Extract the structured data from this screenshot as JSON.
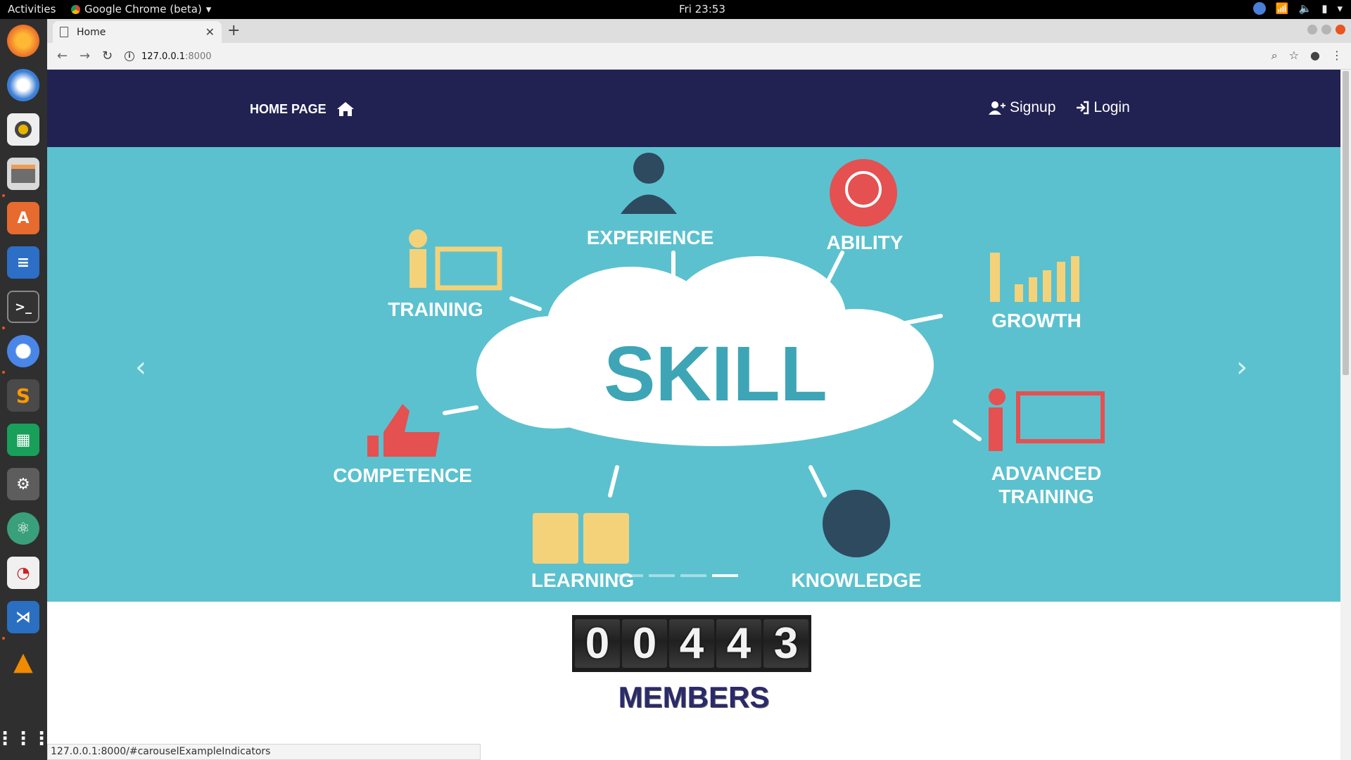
{
  "topbar": {
    "activities": "Activities",
    "app_name": "Google Chrome (beta)",
    "clock": "Fri 23:53"
  },
  "dock": {
    "apps": [
      "firefox-icon",
      "thunderbird-icon",
      "rhythmbox-icon",
      "files-icon",
      "software-center-icon",
      "writer-icon",
      "terminal-icon",
      "chromium-icon",
      "sublime-text-icon",
      "calc-icon",
      "settings-icon",
      "atom-icon",
      "evince-icon",
      "vscode-icon",
      "vlc-icon",
      "show-apps-icon"
    ]
  },
  "browser": {
    "tab_title": "Home",
    "url_host": "127.0.0.1",
    "url_port": ":8000"
  },
  "site": {
    "brand": "HOME PAGE",
    "signup": "Signup",
    "login": "Login"
  },
  "carousel": {
    "center_text": "SKILL",
    "labels": [
      "EXPERIENCE",
      "ABILITY",
      "TRAINING",
      "GROWTH",
      "COMPETENCE",
      "ADVANCED",
      "TRAINING",
      "LEARNING",
      "KNOWLEDGE"
    ],
    "indicator_count": 4,
    "active_indicator": 4,
    "colors": {
      "background": "#5bc1cf",
      "dark": "#2e4a5f",
      "yellow": "#f3d27a",
      "red": "#e55050"
    }
  },
  "counter": {
    "digits": [
      "0",
      "0",
      "4",
      "4",
      "3"
    ],
    "caption": "MEMBERS"
  },
  "status_url": "127.0.0.1:8000/#carouselExampleIndicators"
}
